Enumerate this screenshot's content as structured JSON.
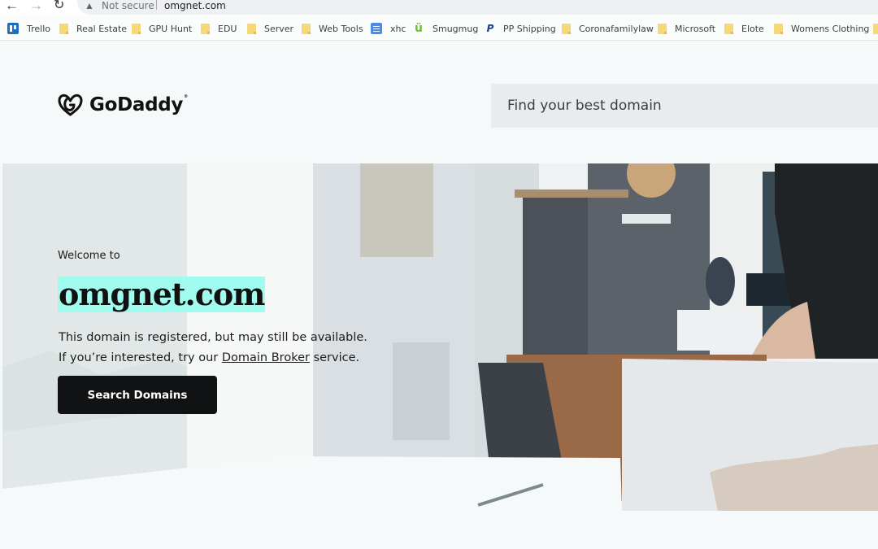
{
  "browser": {
    "nav": {
      "back_icon": "←",
      "forward_icon": "→",
      "reload_icon": "↻"
    },
    "security_warning": "Not secure",
    "url": "omgnet.com",
    "bookmarks": [
      {
        "label": "Trello",
        "icon": "trello-icon"
      },
      {
        "label": "Real Estate",
        "icon": "folder-icon"
      },
      {
        "label": "GPU Hunt",
        "icon": "folder-icon"
      },
      {
        "label": "EDU",
        "icon": "folder-icon"
      },
      {
        "label": "Server",
        "icon": "folder-icon"
      },
      {
        "label": "Web Tools",
        "icon": "folder-icon"
      },
      {
        "label": "xhc",
        "icon": "doc-icon"
      },
      {
        "label": "Smugmug",
        "icon": "smugmug-icon"
      },
      {
        "label": "PP Shipping",
        "icon": "paypal-icon"
      },
      {
        "label": "Coronafamilylaw",
        "icon": "folder-icon"
      },
      {
        "label": "Microsoft",
        "icon": "folder-icon"
      },
      {
        "label": "Elote",
        "icon": "folder-icon"
      },
      {
        "label": "Womens Clothing",
        "icon": "folder-icon"
      }
    ]
  },
  "header": {
    "brand": "GoDaddy",
    "brand_tm": "®",
    "search_placeholder": "Find your best domain"
  },
  "hero": {
    "welcome": "Welcome to",
    "domain": "omgnet.com",
    "line1": "This domain is registered, but may still be available.",
    "line2_prefix": "If you’re interested, try our ",
    "line2_link": "Domain Broker",
    "line2_suffix": " service.",
    "cta_label": "Search Domains"
  },
  "colors": {
    "highlight": "#9ffcef",
    "button_bg": "#111214",
    "page_bg": "#f6f9fa"
  }
}
